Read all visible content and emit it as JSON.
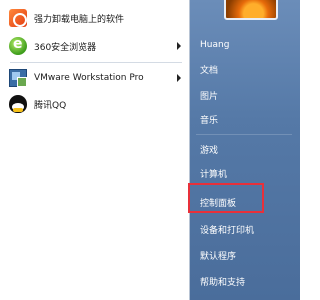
{
  "left_pane": {
    "items": [
      {
        "label": "强力卸载电脑上的软件",
        "icon": "uninstall-icon",
        "submenu": false
      },
      {
        "label": "360安全浏览器",
        "icon": "browser-360-icon",
        "submenu": true
      },
      {
        "label": "VMware Workstation Pro",
        "icon": "vmware-icon",
        "submenu": true
      },
      {
        "label": "腾讯QQ",
        "icon": "qq-penguin-icon",
        "submenu": false
      }
    ]
  },
  "right_pane": {
    "user_name": "Huang",
    "items": [
      {
        "label": "文档"
      },
      {
        "label": "图片"
      },
      {
        "label": "音乐"
      },
      {
        "label": "游戏"
      },
      {
        "label": "计算机"
      },
      {
        "label": "控制面板"
      },
      {
        "label": "设备和打印机"
      },
      {
        "label": "默认程序"
      },
      {
        "label": "帮助和支持"
      }
    ],
    "highlighted_item": "控制面板"
  },
  "colors": {
    "right_pane_bg": "#5579a7",
    "highlight_border": "#e8303a"
  }
}
